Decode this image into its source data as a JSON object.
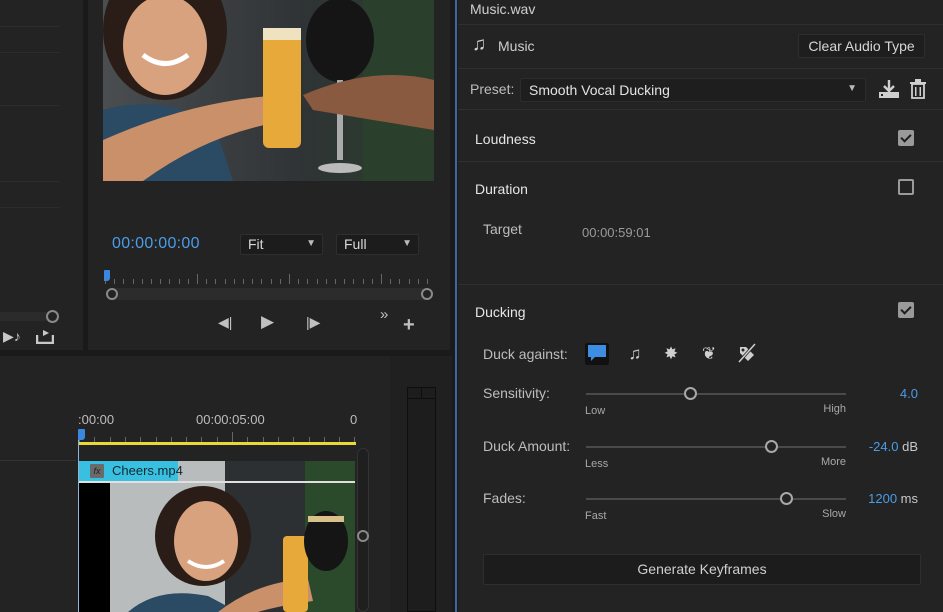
{
  "project_panel": {
    "icons": [
      "insert-to-audio-icon",
      "export-icon"
    ]
  },
  "program_monitor": {
    "timecode": "00:00:00:00",
    "zoom_select": "Fit",
    "resolution_select": "Full",
    "playhead_fraction": 0.0,
    "controls": {
      "step_back": "◀|",
      "play": "▶",
      "step_forward": "|▶",
      "more": "»",
      "add": "+"
    },
    "frame_description": "Three people toasting with beer glasses"
  },
  "timeline": {
    "time_labels": [
      ":00:00",
      "00:00:05:00",
      "0"
    ],
    "clip": {
      "fx_badge": "fx",
      "name": "Cheers.mp4"
    }
  },
  "essential_sound": {
    "clip_name": "Music.wav",
    "audio_type": "Music",
    "clear_button": "Clear Audio Type",
    "preset_label": "Preset:",
    "preset_value": "Smooth Vocal Ducking",
    "sections": {
      "loudness": {
        "title": "Loudness",
        "checked": true
      },
      "duration": {
        "title": "Duration",
        "checked": false,
        "target_label": "Target",
        "target_value": "00:00:59:01"
      },
      "ducking": {
        "title": "Ducking",
        "checked": true,
        "duck_against_label": "Duck against:",
        "duck_against_icons": [
          {
            "name": "dialogue-icon",
            "glyph": "💬",
            "active": true
          },
          {
            "name": "music-icon",
            "glyph": "♫",
            "active": false
          },
          {
            "name": "sfx-icon",
            "glyph": "✸",
            "active": false
          },
          {
            "name": "ambience-icon",
            "glyph": "❦",
            "active": false
          },
          {
            "name": "untagged-icon",
            "glyph": "⊘",
            "active": false
          }
        ],
        "sliders": [
          {
            "label": "Sensitivity:",
            "min_label": "Low",
            "max_label": "High",
            "value": "4.0",
            "unit": "",
            "fraction": 0.4
          },
          {
            "label": "Duck Amount:",
            "min_label": "Less",
            "max_label": "More",
            "value": "-24.0",
            "unit": " dB",
            "fraction": 0.71
          },
          {
            "label": "Fades:",
            "min_label": "Fast",
            "max_label": "Slow",
            "value": "1200",
            "unit": " ms",
            "fraction": 0.77
          }
        ],
        "generate_button": "Generate Keyframes"
      }
    }
  },
  "colors": {
    "accent_blue": "#4a9de8",
    "clip_cyan": "#39c0e0",
    "work_area_yellow": "#e8d83a",
    "panel_bg": "#232323"
  }
}
